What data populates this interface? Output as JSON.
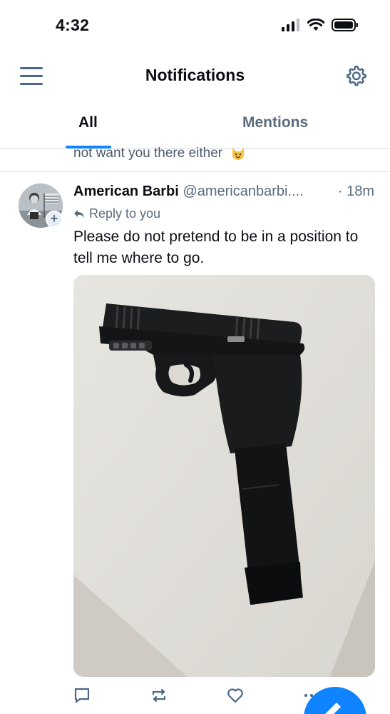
{
  "status_bar": {
    "time": "4:32"
  },
  "header": {
    "title": "Notifications",
    "menu_icon": "hamburger-menu-icon",
    "settings_icon": "gear-icon"
  },
  "tabs": [
    {
      "label": "All",
      "selected": true
    },
    {
      "label": "Mentions",
      "selected": false
    }
  ],
  "previous_item": {
    "text": "not want you there either"
  },
  "post": {
    "display_name": "American Barbi",
    "handle": "@americanbarbi....",
    "time": "· 18m",
    "reply_label": "Reply to you",
    "text": "Please do not pretend to be in a position to tell me where to go."
  },
  "colors": {
    "accent": "#1083fe",
    "muted": "#5b6b7b",
    "icon": "#4a6785"
  }
}
